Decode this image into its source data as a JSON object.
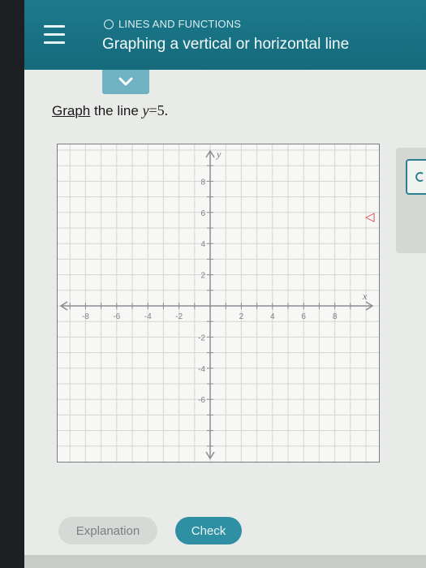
{
  "header": {
    "topic": "LINES AND FUNCTIONS",
    "title": "Graphing a vertical or horizontal line"
  },
  "prompt": {
    "link_text": "Graph",
    "text": " the line ",
    "var": "y",
    "equals": "=",
    "value": "5."
  },
  "graph": {
    "x_label": "x",
    "y_label": "y",
    "x_ticks": [
      "-8",
      "-6",
      "-4",
      "-2",
      "2",
      "4",
      "6",
      "8"
    ],
    "y_ticks": [
      "8",
      "6",
      "4",
      "2",
      "-2",
      "-4",
      "-6"
    ]
  },
  "buttons": {
    "explanation": "Explanation",
    "check": "Check"
  },
  "icons": {
    "menu": "hamburger-menu-icon",
    "chevron": "chevron-down-icon",
    "side_tool": "tool-icon",
    "collapse": "collapse-arrow-icon"
  },
  "colors": {
    "header": "#1d7a8c",
    "chevron_tab": "#6fb3c2",
    "check_button": "#2f8fa3",
    "side_arrow": "#d03a3a"
  }
}
